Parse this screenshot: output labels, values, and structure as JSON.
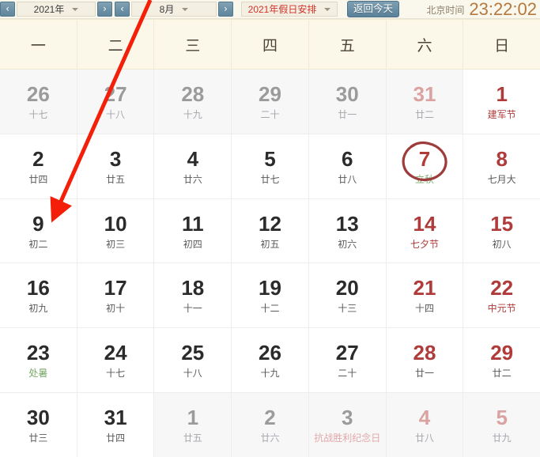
{
  "toolbar": {
    "prev_year_icon": "chevron-left-icon",
    "next_year_icon": "chevron-right-icon",
    "prev_month_icon": "chevron-left-icon",
    "next_month_icon": "chevron-right-icon",
    "year_value": "2021年",
    "month_value": "8月",
    "holiday_value": "2021年假日安排",
    "today_button": "返回今天",
    "clock_label": "北京时间",
    "clock_time": "23:22:02"
  },
  "weekdays": [
    "一",
    "二",
    "三",
    "四",
    "五",
    "六",
    "日"
  ],
  "colors": {
    "accent_red": "#b03b3b",
    "header_bg": "#fbf8e9",
    "toolbar_bg": "#faf7ec",
    "clock": "#b5793f",
    "solar_term_green": "#7aa86a",
    "button_blue": "#6a8fa4"
  },
  "annotations": {
    "today_circle_day": "7",
    "arrow_target_day": "9",
    "arrow_color": "#f41f08"
  },
  "rows": [
    [
      {
        "day": "26",
        "lunar": "十七",
        "day_class": "gray",
        "lunar_class": "gray",
        "other": true
      },
      {
        "day": "27",
        "lunar": "十八",
        "day_class": "gray",
        "lunar_class": "gray",
        "other": true
      },
      {
        "day": "28",
        "lunar": "十九",
        "day_class": "gray",
        "lunar_class": "gray",
        "other": true
      },
      {
        "day": "29",
        "lunar": "二十",
        "day_class": "gray",
        "lunar_class": "gray",
        "other": true
      },
      {
        "day": "30",
        "lunar": "廿一",
        "day_class": "gray",
        "lunar_class": "gray",
        "other": true
      },
      {
        "day": "31",
        "lunar": "廿二",
        "day_class": "pink",
        "lunar_class": "gray",
        "other": true
      },
      {
        "day": "1",
        "lunar": "建军节",
        "day_class": "red",
        "lunar_class": "red",
        "other": false
      }
    ],
    [
      {
        "day": "2",
        "lunar": "廿四",
        "day_class": "",
        "lunar_class": "dark",
        "other": false
      },
      {
        "day": "3",
        "lunar": "廿五",
        "day_class": "",
        "lunar_class": "dark",
        "other": false
      },
      {
        "day": "4",
        "lunar": "廿六",
        "day_class": "",
        "lunar_class": "dark",
        "other": false
      },
      {
        "day": "5",
        "lunar": "廿七",
        "day_class": "",
        "lunar_class": "dark",
        "other": false
      },
      {
        "day": "6",
        "lunar": "廿八",
        "day_class": "",
        "lunar_class": "dark",
        "other": false
      },
      {
        "day": "7",
        "lunar": "立秋",
        "day_class": "red",
        "lunar_class": "green",
        "other": false,
        "today": true
      },
      {
        "day": "8",
        "lunar": "七月大",
        "day_class": "red",
        "lunar_class": "dark",
        "other": false
      }
    ],
    [
      {
        "day": "9",
        "lunar": "初二",
        "day_class": "",
        "lunar_class": "dark",
        "other": false
      },
      {
        "day": "10",
        "lunar": "初三",
        "day_class": "",
        "lunar_class": "dark",
        "other": false
      },
      {
        "day": "11",
        "lunar": "初四",
        "day_class": "",
        "lunar_class": "dark",
        "other": false
      },
      {
        "day": "12",
        "lunar": "初五",
        "day_class": "",
        "lunar_class": "dark",
        "other": false
      },
      {
        "day": "13",
        "lunar": "初六",
        "day_class": "",
        "lunar_class": "dark",
        "other": false
      },
      {
        "day": "14",
        "lunar": "七夕节",
        "day_class": "red",
        "lunar_class": "red",
        "other": false
      },
      {
        "day": "15",
        "lunar": "初八",
        "day_class": "red",
        "lunar_class": "dark",
        "other": false
      }
    ],
    [
      {
        "day": "16",
        "lunar": "初九",
        "day_class": "",
        "lunar_class": "dark",
        "other": false
      },
      {
        "day": "17",
        "lunar": "初十",
        "day_class": "",
        "lunar_class": "dark",
        "other": false
      },
      {
        "day": "18",
        "lunar": "十一",
        "day_class": "",
        "lunar_class": "dark",
        "other": false
      },
      {
        "day": "19",
        "lunar": "十二",
        "day_class": "",
        "lunar_class": "dark",
        "other": false
      },
      {
        "day": "20",
        "lunar": "十三",
        "day_class": "",
        "lunar_class": "dark",
        "other": false
      },
      {
        "day": "21",
        "lunar": "十四",
        "day_class": "red",
        "lunar_class": "dark",
        "other": false
      },
      {
        "day": "22",
        "lunar": "中元节",
        "day_class": "red",
        "lunar_class": "red",
        "other": false
      }
    ],
    [
      {
        "day": "23",
        "lunar": "处暑",
        "day_class": "",
        "lunar_class": "green",
        "other": false
      },
      {
        "day": "24",
        "lunar": "十七",
        "day_class": "",
        "lunar_class": "dark",
        "other": false
      },
      {
        "day": "25",
        "lunar": "十八",
        "day_class": "",
        "lunar_class": "dark",
        "other": false
      },
      {
        "day": "26",
        "lunar": "十九",
        "day_class": "",
        "lunar_class": "dark",
        "other": false
      },
      {
        "day": "27",
        "lunar": "二十",
        "day_class": "",
        "lunar_class": "dark",
        "other": false
      },
      {
        "day": "28",
        "lunar": "廿一",
        "day_class": "red",
        "lunar_class": "dark",
        "other": false
      },
      {
        "day": "29",
        "lunar": "廿二",
        "day_class": "red",
        "lunar_class": "dark",
        "other": false
      }
    ],
    [
      {
        "day": "30",
        "lunar": "廿三",
        "day_class": "",
        "lunar_class": "dark",
        "other": false
      },
      {
        "day": "31",
        "lunar": "廿四",
        "day_class": "",
        "lunar_class": "dark",
        "other": false
      },
      {
        "day": "1",
        "lunar": "廿五",
        "day_class": "gray",
        "lunar_class": "gray",
        "other": true
      },
      {
        "day": "2",
        "lunar": "廿六",
        "day_class": "gray",
        "lunar_class": "gray",
        "other": true
      },
      {
        "day": "3",
        "lunar": "抗战胜利纪念日",
        "day_class": "gray",
        "lunar_class": "pink",
        "other": true
      },
      {
        "day": "4",
        "lunar": "廿八",
        "day_class": "pink",
        "lunar_class": "gray",
        "other": true
      },
      {
        "day": "5",
        "lunar": "廿九",
        "day_class": "pink",
        "lunar_class": "gray",
        "other": true
      }
    ]
  ]
}
